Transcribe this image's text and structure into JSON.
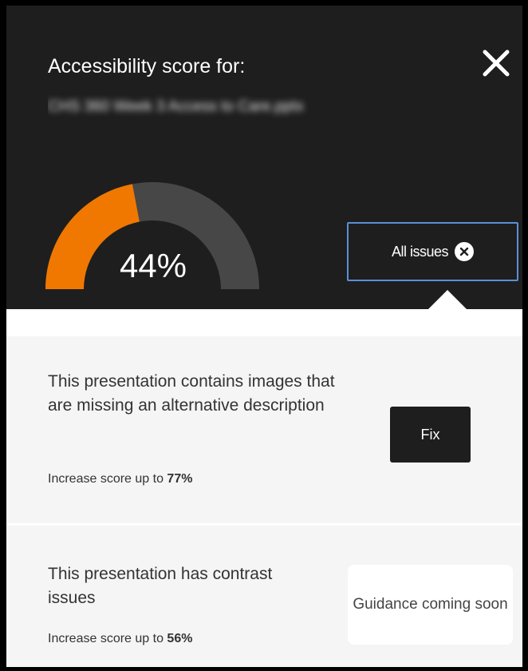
{
  "header": {
    "title": "Accessibility score for:",
    "filename": "CHS 360 Week 3 Access to Care.pptx",
    "close_icon": "close-icon"
  },
  "score": {
    "value_text": "44%",
    "percent": 44,
    "fill_color": "#f07800",
    "track_color": "#474747"
  },
  "filter": {
    "label": "All issues",
    "clear_icon": "x-circle-icon",
    "border_color": "#5b8fd6"
  },
  "issues": [
    {
      "description": "This presentation contains images that are missing an alternative description",
      "increase_prefix": "Increase score up to ",
      "increase_value": "77%",
      "action_label": "Fix"
    },
    {
      "description": "This presentation has contrast issues",
      "increase_prefix": "Increase score up to ",
      "increase_value": "56%",
      "action_label": "Guidance coming soon"
    }
  ]
}
